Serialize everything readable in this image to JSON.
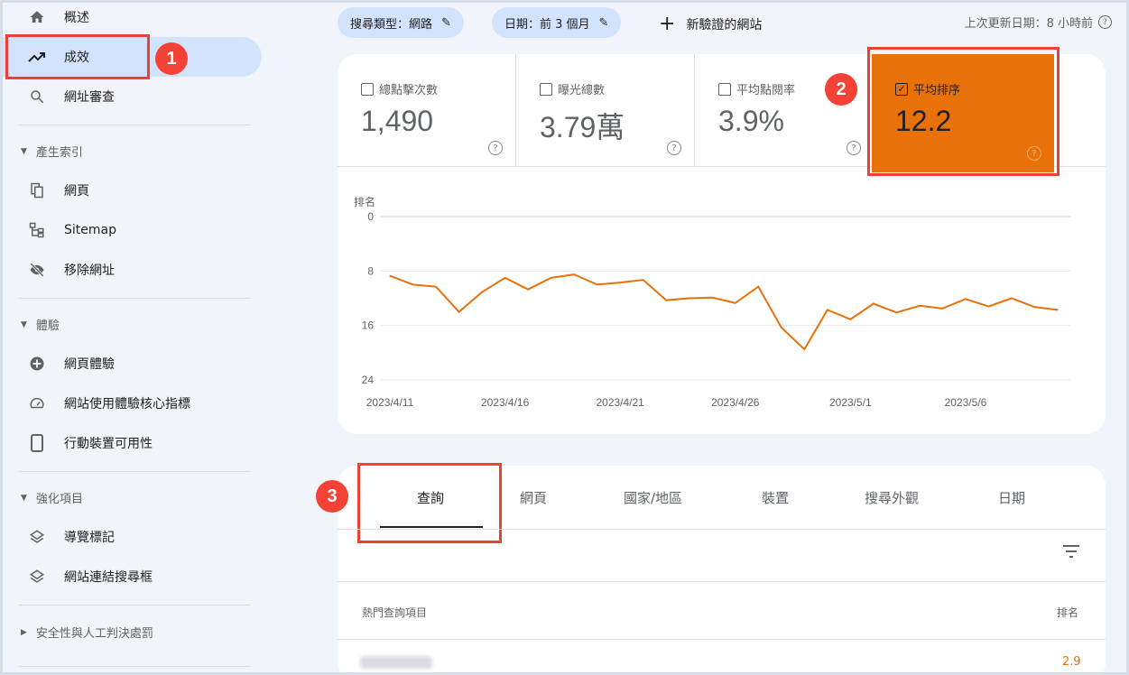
{
  "sidebar": {
    "items": [
      {
        "label": "概述",
        "icon": "home-icon"
      },
      {
        "label": "成效",
        "icon": "trending-up-icon",
        "active": true
      },
      {
        "label": "網址審查",
        "icon": "search-icon"
      }
    ],
    "sections": [
      {
        "title": "產生索引",
        "items": [
          {
            "label": "網頁",
            "icon": "pages-icon"
          },
          {
            "label": "Sitemap",
            "icon": "sitemap-icon"
          },
          {
            "label": "移除網址",
            "icon": "eye-off-icon"
          }
        ]
      },
      {
        "title": "體驗",
        "items": [
          {
            "label": "網頁體驗",
            "icon": "plus-circle-icon"
          },
          {
            "label": "網站使用體驗核心指標",
            "icon": "gauge-icon"
          },
          {
            "label": "行動裝置可用性",
            "icon": "phone-icon"
          }
        ]
      },
      {
        "title": "強化項目",
        "items": [
          {
            "label": "導覽標記",
            "icon": "layers-icon"
          },
          {
            "label": "網站連結搜尋框",
            "icon": "layers-icon"
          }
        ]
      },
      {
        "title": "安全性與人工判決處罰"
      }
    ]
  },
  "toolbar": {
    "search_type": "搜尋類型：網路",
    "date": "日期：前 3 個月",
    "new_label": "新驗證的網站",
    "last_updated": "上次更新日期：8 小時前"
  },
  "metrics": [
    {
      "label": "總點擊次數",
      "value": "1,490",
      "checked": false
    },
    {
      "label": "曝光總數",
      "value": "3.79萬",
      "checked": false
    },
    {
      "label": "平均點閱率",
      "value": "3.9%",
      "checked": false
    },
    {
      "label": "平均排序",
      "value": "12.2",
      "checked": true
    }
  ],
  "badges": [
    "1",
    "2",
    "3"
  ],
  "colors": {
    "accent": "#e8710a",
    "highlight": "#ea4335"
  },
  "chart_data": {
    "type": "line",
    "ylabel": "排名",
    "ylim": [
      0,
      24
    ],
    "y_reversed": true,
    "yticks": [
      "0",
      "8",
      "16",
      "24"
    ],
    "xticks": [
      "2023/4/11",
      "2023/4/16",
      "2023/4/21",
      "2023/4/26",
      "2023/5/1",
      "2023/5/6"
    ],
    "series": [
      {
        "name": "平均排序",
        "values": [
          8.7,
          10.0,
          10.3,
          14.0,
          11.1,
          9.0,
          10.7,
          9.0,
          8.5,
          10.0,
          9.7,
          9.3,
          12.3,
          12.0,
          11.9,
          12.7,
          10.3,
          16.3,
          19.5,
          13.7,
          15.1,
          12.8,
          14.1,
          13.1,
          13.5,
          12.1,
          13.2,
          12.0,
          13.3,
          13.7
        ]
      }
    ],
    "x_start": "2023/4/11"
  },
  "tabs": [
    "查詢",
    "網頁",
    "國家/地區",
    "裝置",
    "搜尋外觀",
    "日期"
  ],
  "table": {
    "col1": "熱門查詢項目",
    "col2": "排名",
    "rows": [
      {
        "query": "",
        "value": "2.9"
      }
    ]
  }
}
